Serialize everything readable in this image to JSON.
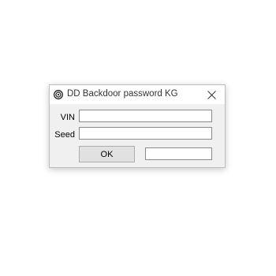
{
  "window": {
    "title": "DD Backdoor password KG",
    "icon": "app-logo-icon",
    "close_icon": "close-icon"
  },
  "form": {
    "vin": {
      "label": "VIN",
      "value": ""
    },
    "seed": {
      "label": "Seed",
      "value": ""
    },
    "ok_label": "OK",
    "result": {
      "value": ""
    }
  }
}
